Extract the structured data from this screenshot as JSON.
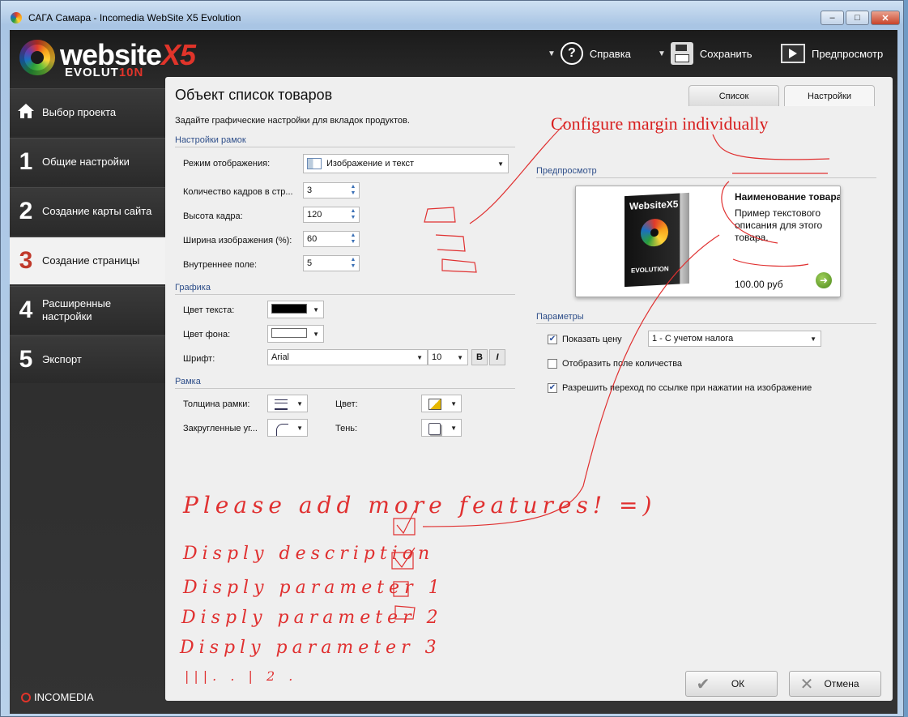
{
  "window": {
    "title": "САГА Самара - Incomedia WebSite X5 Evolution",
    "min_label": "–",
    "max_label": "□",
    "close_label": "✕"
  },
  "logo": {
    "word": "website",
    "x5": "X5",
    "sub_a": "EVOLUT",
    "sub_b": "10N"
  },
  "toolbar": {
    "help_label": "Справка",
    "save_label": "Сохранить",
    "preview_label": "Предпросмотр"
  },
  "sidebar": {
    "items": [
      {
        "num": "",
        "label": "Выбор проекта"
      },
      {
        "num": "1",
        "label": "Общие настройки"
      },
      {
        "num": "2",
        "label": "Создание карты сайта"
      },
      {
        "num": "3",
        "label": "Создание страницы"
      },
      {
        "num": "4",
        "label": "Расширенные настройки"
      },
      {
        "num": "5",
        "label": "Экспорт"
      }
    ],
    "footer": "INCOMEDIA"
  },
  "page": {
    "title": "Объект список товаров",
    "tabs": [
      "Список",
      "Настройки"
    ],
    "description": "Задайте графические настройки для вкладок продуктов."
  },
  "frames": {
    "section": "Настройки рамок",
    "display_mode_label": "Режим отображения:",
    "display_mode_value": "Изображение и текст",
    "frames_per_row_label": "Количество кадров в стр...",
    "frames_per_row_value": "3",
    "frame_height_label": "Высота кадра:",
    "frame_height_value": "120",
    "image_width_label": "Ширина изображения (%):",
    "image_width_value": "60",
    "padding_label": "Внутреннее поле:",
    "padding_value": "5"
  },
  "graphics": {
    "section": "Графика",
    "text_color_label": "Цвет текста:",
    "text_color": "#000000",
    "bg_color_label": "Цвет фона:",
    "bg_color": "#ffffff",
    "font_label": "Шрифт:",
    "font_value": "Arial",
    "font_size": "10",
    "bold": "B",
    "italic": "I"
  },
  "border": {
    "section": "Рамка",
    "thickness_label": "Толщина рамки:",
    "color_label": "Цвет:",
    "rounded_label": "Закругленные уг...",
    "shadow_label": "Тень:"
  },
  "preview": {
    "section": "Предпросмотр",
    "product_name": "Наименование товара",
    "product_text": "Пример текстового описания для этого товара.",
    "price": "100.00 руб",
    "box_title": "WebsiteX5",
    "box_sub": "EVOLUTION"
  },
  "params": {
    "section": "Параметры",
    "show_price_label": "Показать цену",
    "show_price_checked": true,
    "price_mode": "1 - С учетом налога",
    "show_qty_label": "Отобразить поле количества",
    "show_qty_checked": false,
    "link_label": "Разрешить переход по ссылке при нажатии на изображение",
    "link_checked": true
  },
  "footer": {
    "ok_label": "ОК",
    "cancel_label": "Отмена"
  },
  "annotations": {
    "configure_margin": "Configure margin individually",
    "more_features": "Please add more features! =)",
    "line1": "Disply description",
    "line2": "Disply parameter 1",
    "line3": "Disply parameter 2",
    "line4": "Disply parameter 3",
    "line5": "|||. . | 2 ."
  },
  "colors": {
    "accent_red": "#e03030",
    "section_blue": "#2f4f8a",
    "app_dark": "#2b2b2b"
  }
}
